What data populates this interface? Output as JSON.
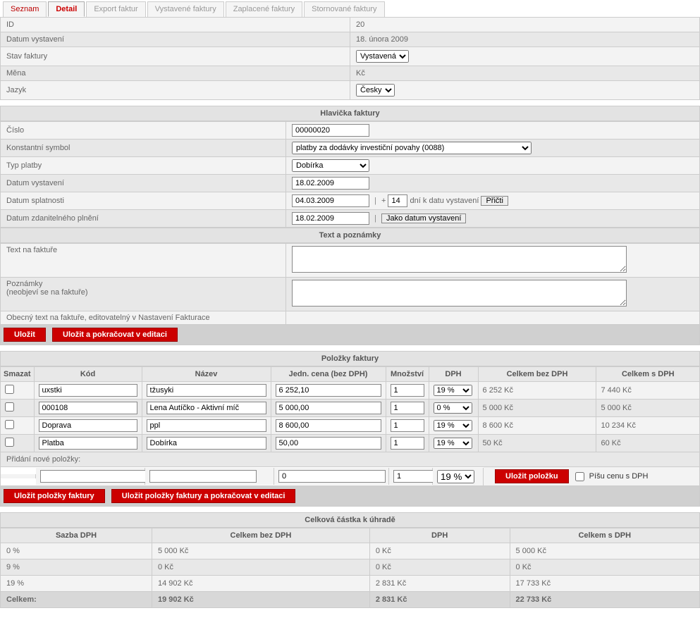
{
  "tabs": [
    "Seznam",
    "Detail",
    "Export faktur",
    "Vystavené faktury",
    "Zaplacené faktury",
    "Stornované faktury"
  ],
  "info": {
    "id_label": "ID",
    "id_val": "20",
    "issued_label": "Datum vystavení",
    "issued_val": "18. února 2009",
    "state_label": "Stav faktury",
    "state_val": "Vystavená",
    "currency_label": "Měna",
    "currency_val": "Kč",
    "lang_label": "Jazyk",
    "lang_val": "Česky"
  },
  "header": {
    "title": "Hlavička faktury",
    "number_label": "Číslo",
    "number_val": "00000020",
    "const_label": "Konstantní symbol",
    "const_val": "platby za dodávky investiční povahy (0088)",
    "paytype_label": "Typ platby",
    "paytype_val": "Dobírka",
    "issued_label": "Datum vystavení",
    "issued_val": "18.02.2009",
    "due_label": "Datum splatnosti",
    "due_val": "04.03.2009",
    "due_sep": "|",
    "due_plus": "+",
    "due_days": "14",
    "due_note": "dní k datu vystavení",
    "due_btn": "Přičti",
    "tax_label": "Datum zdanitelného plnění",
    "tax_val": "18.02.2009",
    "tax_sep": "|",
    "tax_btn": "Jako datum vystavení",
    "notes_title": "Text a poznámky",
    "text_label": "Text na faktuře",
    "text_val": "",
    "note_label": "Poznámky",
    "note_sub": "(neobjeví se na faktuře)",
    "note_val": "",
    "generic_label": "Obecný text na faktuře, editovatelný v Nastavení Fakturace",
    "save": "Uložit",
    "save_cont": "Uložit a pokračovat v editaci"
  },
  "items": {
    "title": "Položky faktury",
    "cols": {
      "del": "Smazat",
      "code": "Kód",
      "name": "Název",
      "price": "Jedn. cena (bez DPH)",
      "qty": "Množství",
      "vat": "DPH",
      "total_ex": "Celkem bez DPH",
      "total_inc": "Celkem s DPH"
    },
    "rows": [
      {
        "code": "uxstki",
        "name": "tžusyki",
        "price": "6 252,10",
        "qty": "1",
        "vat": "19 %",
        "tex": "6 252 Kč",
        "tinc": "7 440 Kč"
      },
      {
        "code": "000108",
        "name": "Lena Autíčko - Aktivní míč",
        "price": "5 000,00",
        "qty": "1",
        "vat": "0 %",
        "tex": "5 000 Kč",
        "tinc": "5 000 Kč"
      },
      {
        "code": "Doprava",
        "name": "ppl",
        "price": "8 600,00",
        "qty": "1",
        "vat": "19 %",
        "tex": "8 600 Kč",
        "tinc": "10 234 Kč"
      },
      {
        "code": "Platba",
        "name": "Dobírka",
        "price": "50,00",
        "qty": "1",
        "vat": "19 %",
        "tex": "50 Kč",
        "tinc": "60 Kč"
      }
    ],
    "new_label": "Přidání nové položky:",
    "new": {
      "code": "",
      "name": "",
      "price": "0",
      "qty": "1",
      "vat": "19 %"
    },
    "new_save": "Uložit položku",
    "price_inc_chk": "Píšu cenu s DPH",
    "save": "Uložit položky faktury",
    "save_cont": "Uložit položky faktury a pokračovat v editaci"
  },
  "totals": {
    "title": "Celková částka k úhradě",
    "cols": {
      "rate": "Sazba DPH",
      "ex": "Celkem bez DPH",
      "vat": "DPH",
      "inc": "Celkem s DPH"
    },
    "rows": [
      {
        "rate": "0 %",
        "ex": "5 000 Kč",
        "vat": "0 Kč",
        "inc": "5 000 Kč"
      },
      {
        "rate": "9 %",
        "ex": "0 Kč",
        "vat": "0 Kč",
        "inc": "0 Kč"
      },
      {
        "rate": "19 %",
        "ex": "14 902 Kč",
        "vat": "2 831 Kč",
        "inc": "17 733 Kč"
      }
    ],
    "total": {
      "label": "Celkem:",
      "ex": "19 902 Kč",
      "vat": "2 831 Kč",
      "inc": "22 733 Kč"
    }
  }
}
